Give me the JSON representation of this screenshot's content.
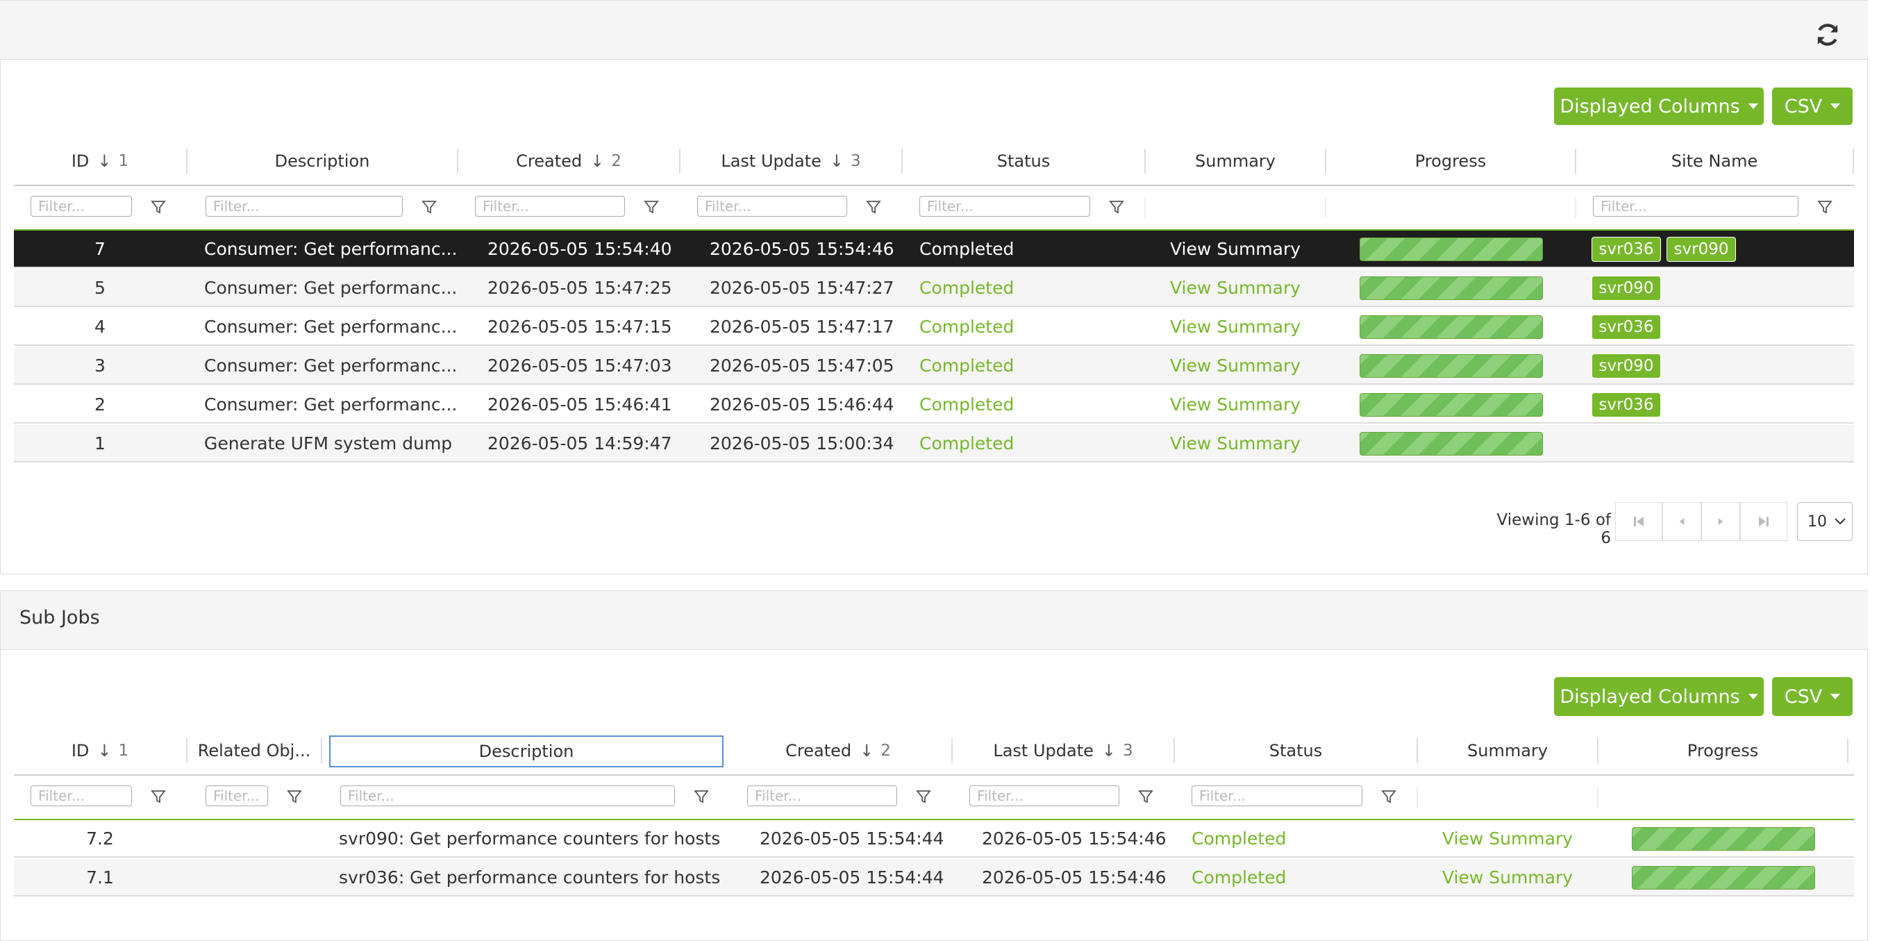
{
  "main_panel": {
    "displayed_columns_label": "Displayed Columns",
    "csv_label": "CSV",
    "columns": [
      {
        "label": "ID",
        "sort_index": "1"
      },
      {
        "label": "Description"
      },
      {
        "label": "Created",
        "sort_index": "2"
      },
      {
        "label": "Last Update",
        "sort_index": "3"
      },
      {
        "label": "Status"
      },
      {
        "label": "Summary"
      },
      {
        "label": "Progress"
      },
      {
        "label": "Site Name"
      }
    ],
    "filter_placeholder": "Filter...",
    "rows": [
      {
        "id": "7",
        "description": "Consumer: Get performanc...",
        "created": "2026-05-05 15:54:40",
        "last_update": "2026-05-05 15:54:46",
        "status": "Completed",
        "summary": "View Summary",
        "progress": 100,
        "sites": [
          "svr036",
          "svr090"
        ],
        "selected": true
      },
      {
        "id": "5",
        "description": "Consumer: Get performanc...",
        "created": "2026-05-05 15:47:25",
        "last_update": "2026-05-05 15:47:27",
        "status": "Completed",
        "summary": "View Summary",
        "progress": 100,
        "sites": [
          "svr090"
        ]
      },
      {
        "id": "4",
        "description": "Consumer: Get performanc...",
        "created": "2026-05-05 15:47:15",
        "last_update": "2026-05-05 15:47:17",
        "status": "Completed",
        "summary": "View Summary",
        "progress": 100,
        "sites": [
          "svr036"
        ]
      },
      {
        "id": "3",
        "description": "Consumer: Get performanc...",
        "created": "2026-05-05 15:47:03",
        "last_update": "2026-05-05 15:47:05",
        "status": "Completed",
        "summary": "View Summary",
        "progress": 100,
        "sites": [
          "svr090"
        ]
      },
      {
        "id": "2",
        "description": "Consumer: Get performanc...",
        "created": "2026-05-05 15:46:41",
        "last_update": "2026-05-05 15:46:44",
        "status": "Completed",
        "summary": "View Summary",
        "progress": 100,
        "sites": [
          "svr036"
        ]
      },
      {
        "id": "1",
        "description": "Generate UFM system dump",
        "created": "2026-05-05 14:59:47",
        "last_update": "2026-05-05 15:00:34",
        "status": "Completed",
        "summary": "View Summary",
        "progress": 100,
        "sites": []
      }
    ],
    "viewing_text": "Viewing 1-6 of 6",
    "page_size": "10"
  },
  "sub_jobs": {
    "title": "Sub Jobs",
    "displayed_columns_label": "Displayed Columns",
    "csv_label": "CSV",
    "columns": [
      {
        "label": "ID",
        "sort_index": "1"
      },
      {
        "label": "Related Obj..."
      },
      {
        "label": "Description"
      },
      {
        "label": "Created",
        "sort_index": "2"
      },
      {
        "label": "Last Update",
        "sort_index": "3"
      },
      {
        "label": "Status"
      },
      {
        "label": "Summary"
      },
      {
        "label": "Progress"
      }
    ],
    "filter_placeholder": "Filter...",
    "rows": [
      {
        "id": "7.2",
        "related": "",
        "description": "svr090: Get performance counters for hosts",
        "created": "2026-05-05 15:54:44",
        "last_update": "2026-05-05 15:54:46",
        "status": "Completed",
        "summary": "View Summary",
        "progress": 100
      },
      {
        "id": "7.1",
        "related": "",
        "description": "svr036: Get performance counters for hosts",
        "created": "2026-05-05 15:54:44",
        "last_update": "2026-05-05 15:54:46",
        "status": "Completed",
        "summary": "View Summary",
        "progress": 100
      }
    ]
  },
  "colors": {
    "accent": "#76b82a",
    "selected_row": "#1e1e1e"
  },
  "icons": {
    "refresh": "refresh-icon",
    "filter": "filter-icon",
    "sort": "sort-down-arrow-icon",
    "first": "first-page-icon",
    "prev": "prev-page-icon",
    "next": "next-page-icon",
    "last": "last-page-icon"
  }
}
